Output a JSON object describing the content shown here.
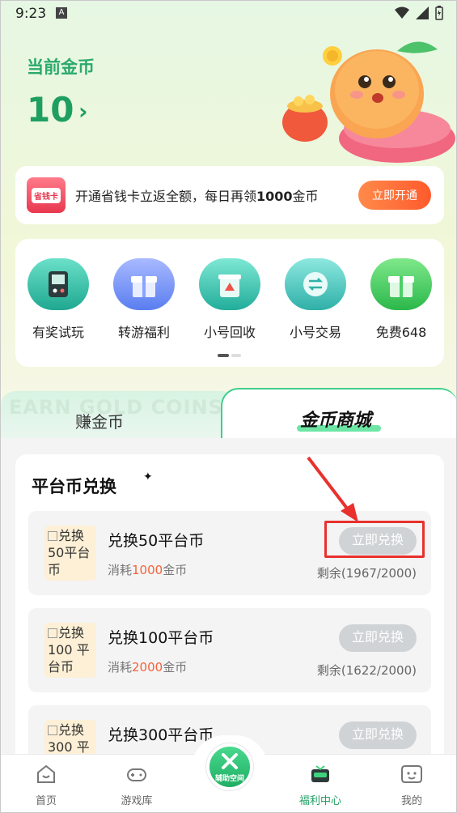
{
  "status_bar": {
    "time": "9:23",
    "notification_badge": "A"
  },
  "header": {
    "coin_label": "当前金币",
    "coin_value": "10",
    "arrow": "›"
  },
  "promo": {
    "badge": "省钱卡",
    "text_prefix": "开通省钱卡立返全额，每日再领",
    "text_bold": "1000",
    "text_suffix": "金币",
    "button": "立即开通"
  },
  "features": [
    {
      "label": "有奖试玩",
      "icon": "gamepad-icon",
      "color": "#2ab8a8"
    },
    {
      "label": "转游福利",
      "icon": "gift-icon",
      "color": "#5a7ef0"
    },
    {
      "label": "小号回收",
      "icon": "recycle-box-icon",
      "color": "#26b7a4"
    },
    {
      "label": "小号交易",
      "icon": "exchange-coin-icon",
      "color": "#2fb8b0"
    },
    {
      "label": "免费648",
      "icon": "green-gift-icon",
      "color": "#34c257"
    }
  ],
  "tabs": {
    "bg_text": "EARN GOLD COINS",
    "earn": "赚金币",
    "shop": "金币商城"
  },
  "section": {
    "title": "平台币兑换",
    "sparkle": "✦"
  },
  "items": [
    {
      "thumb_lines": [
        "兑换",
        "50平台",
        "币"
      ],
      "title_prefix": "兑换",
      "title_num": "50",
      "title_suffix": "平台币",
      "cost_prefix": "消耗",
      "cost_num": "1000",
      "cost_suffix": "金币",
      "button": "立即兑换",
      "left": "剩余(1967/2000)"
    },
    {
      "thumb_lines": [
        "兑换",
        "100 平",
        "台币"
      ],
      "title_prefix": "兑换",
      "title_num": "100",
      "title_suffix": "平台币",
      "cost_prefix": "消耗",
      "cost_num": "2000",
      "cost_suffix": "金币",
      "button": "立即兑换",
      "left": "剩余(1622/2000)"
    },
    {
      "thumb_lines": [
        "兑换",
        "300 平"
      ],
      "title_prefix": "兑换",
      "title_num": "300",
      "title_suffix": "平台币",
      "button": "立即兑换"
    }
  ],
  "bottom_nav": {
    "items": [
      {
        "label": "首页",
        "icon": "home-icon"
      },
      {
        "label": "游戏库",
        "icon": "gamepad-outline-icon"
      },
      {
        "label": "辅助空间",
        "icon": "tools-icon"
      },
      {
        "label": "福利中心",
        "icon": "welfare-icon"
      },
      {
        "label": "我的",
        "icon": "profile-icon"
      }
    ]
  },
  "colors": {
    "brand_green": "#1f9e62",
    "accent_orange": "#ff5a2c",
    "cost_red": "#f2623a",
    "highlight_red": "#e8312e"
  }
}
